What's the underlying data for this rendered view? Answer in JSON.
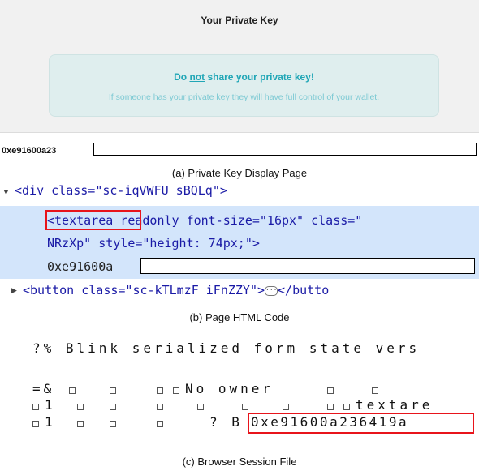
{
  "panel_a": {
    "title": "Your Private Key",
    "warning_prefix": "Do ",
    "warning_underlined": "not",
    "warning_suffix": " share your private key!",
    "warning_body": "If someone has your private key they will have full control of your wallet.",
    "key_prefix": "0xe91600a23"
  },
  "panel_b": {
    "line0": "<div class=\"sc-iqVWFU sBQLq\">",
    "line1_tag": "<textarea",
    "line1_rest": " readonly font-size=\"16px\" class=\"",
    "line2": "NRzXp\" style=\"height: 74px;\">",
    "line3": "0xe91600a",
    "line4_a": "<button class=\"sc-kTLmzF iFnZZY\">",
    "line4_b": "</butto"
  },
  "panel_c": {
    "line1": "?% Blink serialized form state vers",
    "line2": "=&",
    "line2_b": "No owner",
    "line3_num": "1",
    "line3_end": "textare",
    "line4_num": "1",
    "line4_mid": "? B",
    "line4_key": "0xe91600a236419a"
  },
  "captions": {
    "a": "(a) Private Key Display Page",
    "b": "(b) Page HTML Code",
    "c": "(c) Browser Session File"
  },
  "colors": {
    "warning_text": "#20a6b6",
    "highlight_box": "#e8141b",
    "code_blue": "#1a1aa6",
    "selection_bg": "#d3e5fb"
  }
}
